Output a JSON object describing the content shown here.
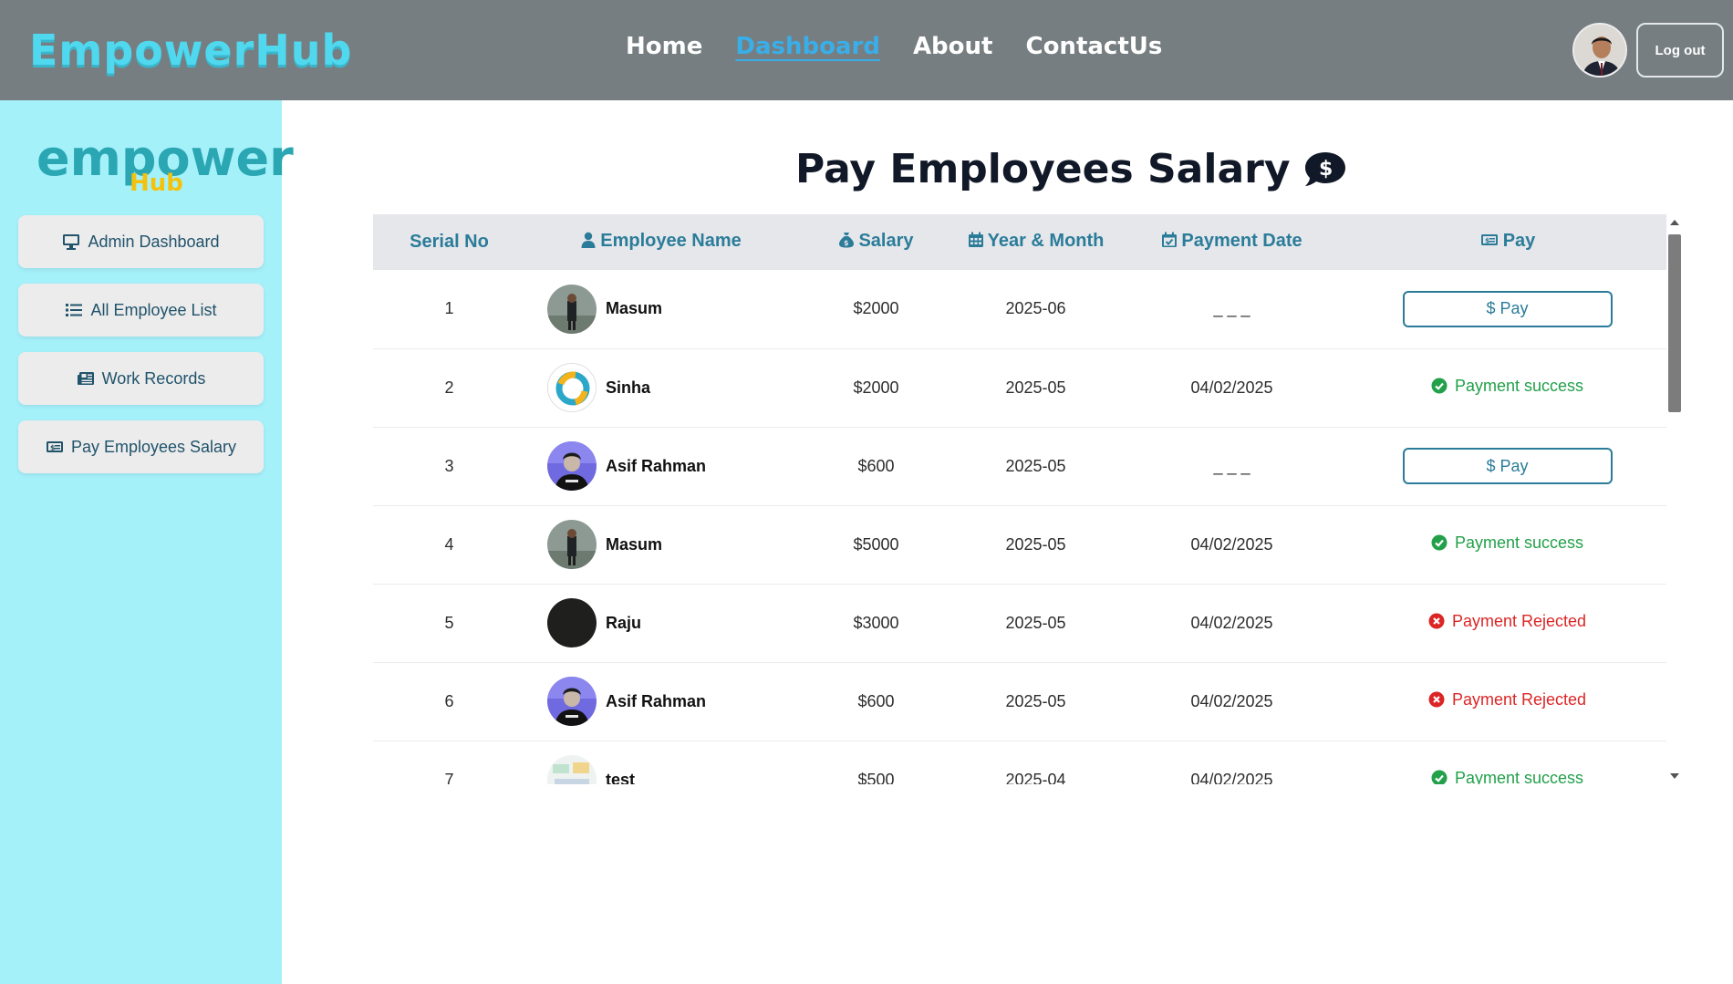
{
  "brand": {
    "name": "EmpowerHub",
    "accent": "#4fd8ee"
  },
  "nav": {
    "links": [
      {
        "label": "Home",
        "active": false
      },
      {
        "label": "Dashboard",
        "active": true
      },
      {
        "label": "About",
        "active": false
      },
      {
        "label": "ContactUs",
        "active": false
      }
    ],
    "logout_label": "Log out"
  },
  "sidebar": {
    "logo_top": "empower",
    "logo_bottom": "Hub",
    "items": [
      {
        "label": "Admin Dashboard",
        "icon": "monitor-icon"
      },
      {
        "label": "All Employee List",
        "icon": "list-icon"
      },
      {
        "label": "Work Records",
        "icon": "newspaper-icon"
      },
      {
        "label": "Pay Employees Salary",
        "icon": "money-bill-icon"
      }
    ]
  },
  "main": {
    "title": "Pay Employees Salary",
    "title_icon": "comment-dollar-icon",
    "columns": [
      {
        "label": "Serial No",
        "icon": ""
      },
      {
        "label": "Employee Name",
        "icon": "user-icon"
      },
      {
        "label": "Salary",
        "icon": "money-bag-icon"
      },
      {
        "label": "Year & Month",
        "icon": "calendar-icon"
      },
      {
        "label": "Payment Date",
        "icon": "calendar-check-icon"
      },
      {
        "label": "Pay",
        "icon": "money-bill-icon"
      }
    ],
    "rows": [
      {
        "serial": "1",
        "name": "Masum",
        "salary": "$2000",
        "year_month": "2025-06",
        "payment_date": "_ _ _",
        "pay": "$ Pay",
        "pay_state": "button"
      },
      {
        "serial": "2",
        "name": "Sinha",
        "salary": "$2000",
        "year_month": "2025-05",
        "payment_date": "04/02/2025",
        "pay": "Payment success",
        "pay_state": "success"
      },
      {
        "serial": "3",
        "name": "Asif Rahman",
        "salary": "$600",
        "year_month": "2025-05",
        "payment_date": "_ _ _",
        "pay": "$ Pay",
        "pay_state": "button"
      },
      {
        "serial": "4",
        "name": "Masum",
        "salary": "$5000",
        "year_month": "2025-05",
        "payment_date": "04/02/2025",
        "pay": "Payment success",
        "pay_state": "success"
      },
      {
        "serial": "5",
        "name": "Raju",
        "salary": "$3000",
        "year_month": "2025-05",
        "payment_date": "04/02/2025",
        "pay": "Payment Rejected",
        "pay_state": "rejected"
      },
      {
        "serial": "6",
        "name": "Asif Rahman",
        "salary": "$600",
        "year_month": "2025-05",
        "payment_date": "04/02/2025",
        "pay": "Payment Rejected",
        "pay_state": "rejected"
      },
      {
        "serial": "7",
        "name": "test",
        "salary": "$500",
        "year_month": "2025-04",
        "payment_date": "04/02/2025",
        "pay": "Payment success",
        "pay_state": "success"
      }
    ]
  },
  "colors": {
    "navbar": "#767e81",
    "sidebar": "#a5f1fa",
    "header_text": "#2b7c99",
    "success": "#22a04a",
    "rejected": "#dc2626"
  }
}
